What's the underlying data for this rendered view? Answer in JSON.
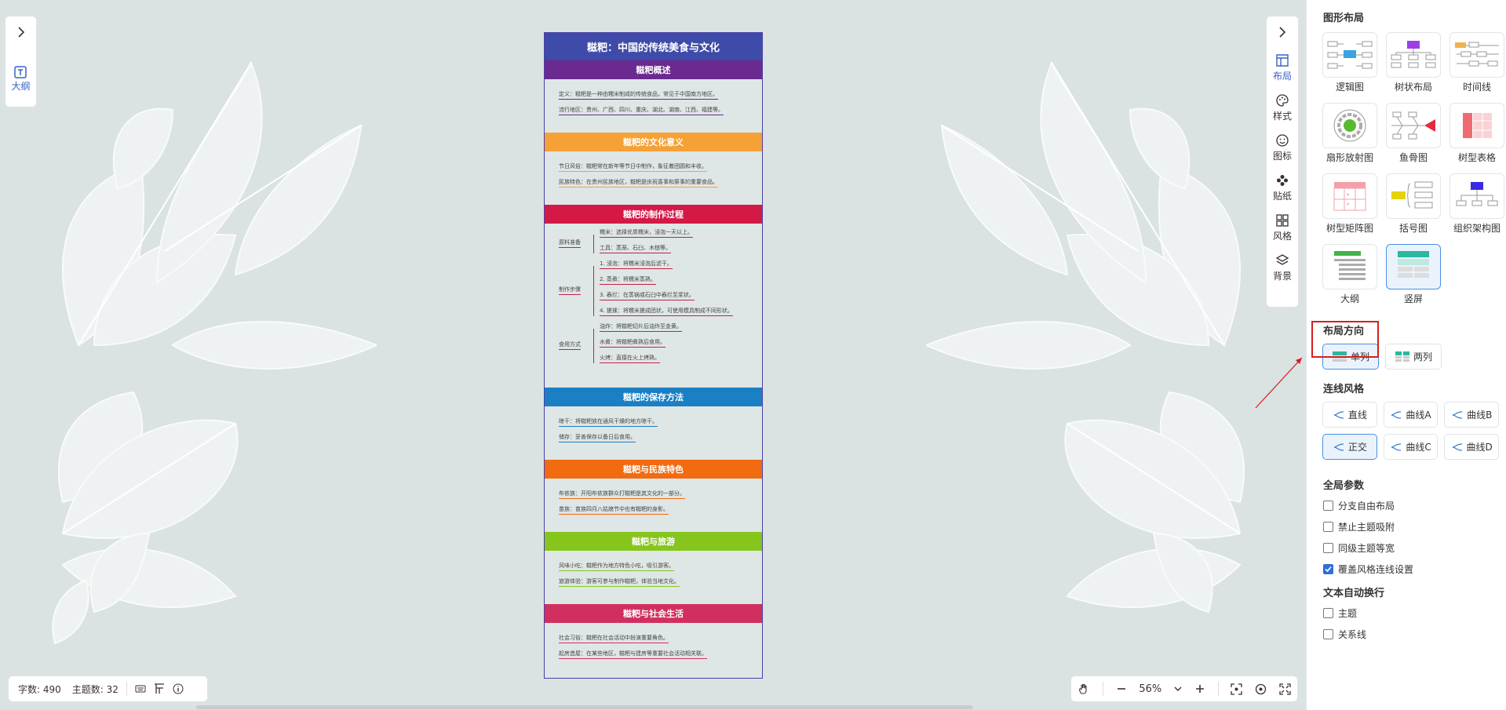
{
  "outline": {
    "label": "大纲"
  },
  "right_tools": [
    {
      "label": "布局",
      "icon": "layout-icon",
      "active": true
    },
    {
      "label": "样式",
      "icon": "palette-icon",
      "active": false
    },
    {
      "label": "图标",
      "icon": "smiley-icon",
      "active": false
    },
    {
      "label": "贴纸",
      "icon": "sticker-icon",
      "active": false
    },
    {
      "label": "风格",
      "icon": "grid-style-icon",
      "active": false
    },
    {
      "label": "背景",
      "icon": "layers-icon",
      "active": false
    }
  ],
  "mindmap": {
    "title": "糍粑：中国的传统美食与文化",
    "sections": [
      {
        "title": "糍粑概述",
        "color": "#6b2a8f",
        "items": [
          "定义：糍粑是一种由糯米制成的传统食品，常见于中国南方地区。",
          "流行地区：贵州、广西、四川、重庆、湖北、湖南、江西、福建等。"
        ]
      },
      {
        "title": "糍粑的文化意义",
        "color": "#f5a135",
        "items": [
          "节日风俗：糍粑常在新年等节日中制作，象征着团圆和丰收。",
          "民族特色：在贵州民族地区，糍粑是庆祝喜事和祭事的重要食品。"
        ]
      },
      {
        "title": "糍粑的制作过程",
        "color": "#d41947",
        "groups": [
          {
            "label": "原料准备",
            "items": [
              "糯米：选择优质糯米，浸泡一天以上。",
              "工具：蒸笼、石臼、木槌等。"
            ]
          },
          {
            "label": "制作步骤",
            "items": [
              "1. 浸泡：将糯米浸泡后滤干。",
              "2. 蒸煮：将糯米蒸熟。",
              "3. 舂烂：在蒸锅或石臼中舂烂至浆状。",
              "4. 搓揉：将糯米搓成团状，可使用模具制成不同形状。"
            ]
          },
          {
            "label": "食用方式",
            "items": [
              "油炸：将糍粑切片后油炸至金黄。",
              "水煮：将糍粑煮熟后食用。",
              "火烤：直接在火上烤熟。"
            ]
          }
        ]
      },
      {
        "title": "糍粑的保存方法",
        "color": "#1b7fc4",
        "items": [
          "晾干：将糍粑放在通风干燥的地方晾干。",
          "储存：妥善保存以备日后食用。"
        ]
      },
      {
        "title": "糍粑与民族特色",
        "color": "#f26b10",
        "items": [
          "布依族：开阳布依族群众打糍粑是其文化的一部分。",
          "苗族：苗族四月八姑娘节中也有糍粑的身影。"
        ]
      },
      {
        "title": "糍粑与旅游",
        "color": "#86c51b",
        "items": [
          "风味小吃：糍粑作为地方特色小吃，吸引游客。",
          "旅游体验：游客可参与制作糍粑，体验当地文化。"
        ]
      },
      {
        "title": "糍粑与社会生活",
        "color": "#d12f60",
        "items": [
          "社会习俗：糍粑在社会活动中扮演重要角色。",
          "起房造屋：在某些地区，糍粑与建房等重要社会活动相关联。"
        ]
      }
    ]
  },
  "status": {
    "word_count": "字数: 490",
    "topic_count": "主题数: 32"
  },
  "zoom": {
    "value": "56%"
  },
  "panel": {
    "graph_layout_title": "图形布局",
    "layouts": [
      {
        "label": "逻辑图",
        "selected": false
      },
      {
        "label": "树状布局",
        "selected": false
      },
      {
        "label": "时间线",
        "selected": false
      },
      {
        "label": "扇形放射图",
        "selected": false
      },
      {
        "label": "鱼骨图",
        "selected": false
      },
      {
        "label": "树型表格",
        "selected": false
      },
      {
        "label": "树型矩阵图",
        "selected": false
      },
      {
        "label": "括号图",
        "selected": false
      },
      {
        "label": "组织架构图",
        "selected": false
      },
      {
        "label": "大纲",
        "selected": false
      },
      {
        "label": "竖屏",
        "selected": true
      }
    ],
    "direction_title": "布局方向",
    "directions": [
      {
        "label": "单列",
        "selected": true
      },
      {
        "label": "两列",
        "selected": false
      }
    ],
    "line_style_title": "连线风格",
    "line_styles": [
      {
        "label": "直线",
        "selected": false
      },
      {
        "label": "曲线A",
        "selected": false
      },
      {
        "label": "曲线B",
        "selected": false
      },
      {
        "label": "正交",
        "selected": true
      },
      {
        "label": "曲线C",
        "selected": false
      },
      {
        "label": "曲线D",
        "selected": false
      }
    ],
    "global_title": "全局参数",
    "global_options": [
      {
        "label": "分支自由布局",
        "checked": false
      },
      {
        "label": "禁止主题吸附",
        "checked": false
      },
      {
        "label": "同级主题等宽",
        "checked": false
      },
      {
        "label": "覆盖风格连线设置",
        "checked": true
      }
    ],
    "wrap_title": "文本自动换行",
    "wrap_options": [
      {
        "label": "主题",
        "checked": false
      },
      {
        "label": "关系线",
        "checked": false
      }
    ]
  }
}
